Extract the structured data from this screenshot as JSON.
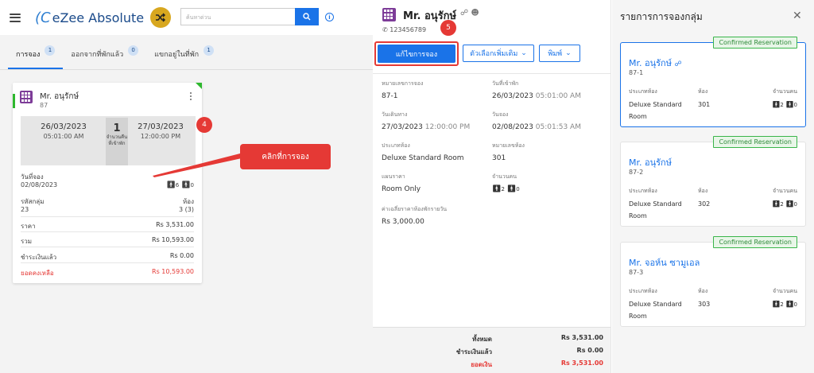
{
  "app": {
    "logo_text": "eZee Absolute",
    "search_placeholder": "ค้นหาด่วน"
  },
  "tabs": [
    {
      "label": "การจอง",
      "count": "1"
    },
    {
      "label": "ออกจากที่พักแล้ว",
      "count": "0"
    },
    {
      "label": "แขกอยู่ในที่พัก",
      "count": "1"
    }
  ],
  "card": {
    "guest": "Mr. อนุรักษ์",
    "number": "87",
    "arrival_date": "26/03/2023",
    "arrival_time": "05:01:00 AM",
    "nights": "1",
    "nights_label": "จำนวนคืนที่เข้าพัก",
    "departure_date": "27/03/2023",
    "departure_time": "12:00:00 PM",
    "booking_date_label": "วันที่จอง",
    "booking_date": "02/08/2023",
    "adults": "6",
    "children": "0",
    "group_code_label": "รหัสกลุ่ม",
    "group_code": "23",
    "rooms_label": "ห้อง",
    "rooms": "3 (3)",
    "rate_label": "ราคา",
    "rate": "Rs 3,531.00",
    "total_label": "รวม",
    "total": "Rs 10,593.00",
    "paid_label": "ชำระเงินแล้ว",
    "paid": "Rs 0.00",
    "balance_label": "ยอดคงเหลือ",
    "balance": "Rs 10,593.00"
  },
  "annotations": {
    "step4": "4",
    "step5": "5",
    "click_label": "คลิกที่การจอง"
  },
  "detail": {
    "title": "Mr. อนุรักษ์",
    "phone": "123456789",
    "edit_button": "แก้ไขการจอง",
    "more_button": "ตัวเลือกเพิ่มเติม",
    "print_button": "พิมพ์",
    "fields": {
      "res_no_label": "หมายเลขการจอง",
      "res_no": "87-1",
      "checkin_label": "วันที่เข้าพัก",
      "checkin_date": "26/03/2023",
      "checkin_time": "05:01:00 AM",
      "checkout_label": "วันเดินทาง",
      "checkout_date": "27/03/2023",
      "checkout_time": "12:00:00 PM",
      "booked_label": "วันจอง",
      "booked_date": "02/08/2023",
      "booked_time": "05:01:53 AM",
      "room_type_label": "ประเภทห้อง",
      "room_type": "Deluxe Standard Room",
      "room_no_label": "หมายเลขห้อง",
      "room_no": "301",
      "rate_plan_label": "แผนราคา",
      "rate_plan": "Room Only",
      "pax_label": "จำนวนคน",
      "adults": "2",
      "children": "0",
      "avg_rate_label": "ค่าเฉลี่ยราคาห้องพักรายวัน",
      "avg_rate": "Rs 3,000.00"
    },
    "footer": {
      "total_label": "ทั้งหมด",
      "total": "Rs 3,531.00",
      "paid_label": "ชำระเงินแล้ว",
      "paid": "Rs 0.00",
      "balance_label": "ยอดเงิน",
      "balance": "Rs 3,531.00"
    }
  },
  "group": {
    "title": "รายการการจองกลุ่ม",
    "col_room_type": "ประเภทห้อง",
    "col_room": "ห้อง",
    "col_pax": "จำนวนคน",
    "items": [
      {
        "status": "Confirmed Reservation",
        "name": "Mr. อนุรักษ์",
        "number": "87-1",
        "room_type": "Deluxe Standard Room",
        "room": "301",
        "adults": "2",
        "children": "0"
      },
      {
        "status": "Confirmed Reservation",
        "name": "Mr. อนุรักษ์",
        "number": "87-2",
        "room_type": "Deluxe Standard Room",
        "room": "302",
        "adults": "2",
        "children": "0"
      },
      {
        "status": "Confirmed Reservation",
        "name": "Mr. จอห์น ซามูเอล",
        "number": "87-3",
        "room_type": "Deluxe Standard Room",
        "room": "303",
        "adults": "2",
        "children": "0"
      }
    ]
  },
  "colors": {
    "accent": "#1a73e8",
    "alert": "#e53935",
    "confirmed": "#39b54a",
    "hotel_icon": "#7d3c98"
  }
}
